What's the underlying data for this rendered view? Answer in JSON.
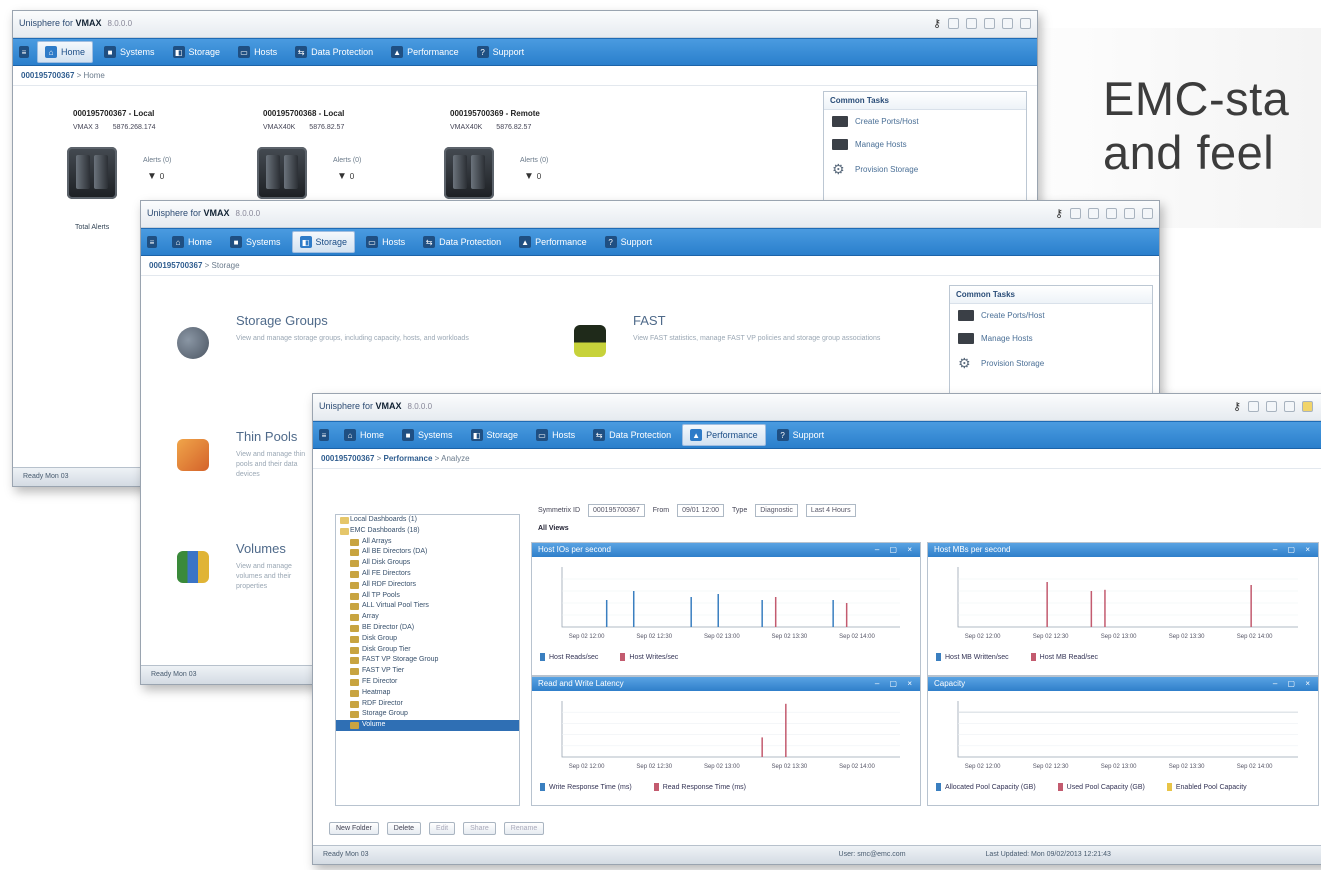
{
  "banner": {
    "line1": "EMC-sta",
    "line2": "and feel"
  },
  "app": {
    "title_prefix": "Unisphere for ",
    "title_bold": "VMAX",
    "version": "8.0.0.0"
  },
  "nav": {
    "w1": [
      {
        "label": "Home",
        "icon": "⌂",
        "active": true
      },
      {
        "label": "Systems",
        "icon": "■",
        "active": false
      },
      {
        "label": "Storage",
        "icon": "◧",
        "active": false
      },
      {
        "label": "Hosts",
        "icon": "▭",
        "active": false
      },
      {
        "label": "Data Protection",
        "icon": "⇆",
        "active": false
      },
      {
        "label": "Performance",
        "icon": "▲",
        "active": false
      },
      {
        "label": "Support",
        "icon": "?",
        "active": false
      }
    ],
    "w2": [
      {
        "label": "Home",
        "icon": "⌂",
        "active": false
      },
      {
        "label": "Systems",
        "icon": "■",
        "active": false
      },
      {
        "label": "Storage",
        "icon": "◧",
        "active": true
      },
      {
        "label": "Hosts",
        "icon": "▭",
        "active": false
      },
      {
        "label": "Data Protection",
        "icon": "⇆",
        "active": false
      },
      {
        "label": "Performance",
        "icon": "▲",
        "active": false
      },
      {
        "label": "Support",
        "icon": "?",
        "active": false
      }
    ],
    "w3": [
      {
        "label": "Home",
        "icon": "⌂",
        "active": false
      },
      {
        "label": "Systems",
        "icon": "■",
        "active": false
      },
      {
        "label": "Storage",
        "icon": "◧",
        "active": false
      },
      {
        "label": "Hosts",
        "icon": "▭",
        "active": false
      },
      {
        "label": "Data Protection",
        "icon": "⇆",
        "active": false
      },
      {
        "label": "Performance",
        "icon": "▲",
        "active": true
      },
      {
        "label": "Support",
        "icon": "?",
        "active": false
      }
    ]
  },
  "crumbs": {
    "w1": {
      "root": "000195700367",
      "sep": " > ",
      "leaf": "Home"
    },
    "w2": {
      "root": "000195700367",
      "sep": " > ",
      "leaf": "Storage"
    },
    "w3": {
      "root": "000195700367",
      "sep": " > ",
      "mid": "Performance",
      "leaf": "Analyze"
    }
  },
  "tasks": {
    "title": "Common Tasks",
    "items": [
      {
        "label": "Create Ports/Host",
        "icon": "server-icon"
      },
      {
        "label": "Manage Hosts",
        "icon": "server-icon"
      },
      {
        "label": "Provision Storage",
        "icon": "gear-icon"
      }
    ]
  },
  "systems": [
    {
      "id": "000195700367 - Local",
      "model": "VMAX 3",
      "ucode": "5876.268.174",
      "alerts_label": "Alerts (0)",
      "alerts": "0"
    },
    {
      "id": "000195700368 - Local",
      "model": "VMAX40K",
      "ucode": "5876.82.57",
      "alerts_label": "Alerts (0)",
      "alerts": "0"
    },
    {
      "id": "000195700369 - Remote",
      "model": "VMAX40K",
      "ucode": "5876.82.57",
      "alerts_label": "Alerts (0)",
      "alerts": "0"
    }
  ],
  "w1_status": "Ready    Mon 03",
  "w1_side_label": "Total Alerts",
  "features": [
    {
      "title": "Storage Groups",
      "desc": "View and manage storage groups, including capacity, hosts, and workloads"
    },
    {
      "title": "FAST",
      "desc": "View FAST statistics, manage FAST VP policies and storage group associations"
    },
    {
      "title": "Thin Pools",
      "desc": "View and manage thin pools and their data devices"
    },
    {
      "title": "Volumes",
      "desc": "View and manage volumes and their properties"
    }
  ],
  "w2_status": "Ready    Mon 03",
  "w3": {
    "toolbar": {
      "sym_label": "Symmetrix ID",
      "sym_value": "000195700367",
      "from_label": "From",
      "from_value": "09/01 12:00",
      "type_label": "Type",
      "type_value": "Diagnostic",
      "range_value": "Last 4 Hours",
      "all_label": "All Views"
    },
    "tree": [
      {
        "label": "Local Dashboards (1)",
        "root": true
      },
      {
        "label": "EMC Dashboards (18)",
        "root": true
      },
      {
        "label": "All Arrays"
      },
      {
        "label": "All BE Directors (DA)"
      },
      {
        "label": "All Disk Groups"
      },
      {
        "label": "All FE Directors"
      },
      {
        "label": "All RDF Directors"
      },
      {
        "label": "All TP Pools"
      },
      {
        "label": "ALL Virtual Pool Tiers"
      },
      {
        "label": "Array"
      },
      {
        "label": "BE Director (DA)"
      },
      {
        "label": "Disk Group"
      },
      {
        "label": "Disk Group Tier"
      },
      {
        "label": "FAST VP Storage Group"
      },
      {
        "label": "FAST VP Tier"
      },
      {
        "label": "FE Director"
      },
      {
        "label": "Heatmap"
      },
      {
        "label": "RDF Director"
      },
      {
        "label": "Storage Group"
      },
      {
        "label": "Volume",
        "selected": true
      }
    ],
    "buttons": [
      "New Folder",
      "Delete",
      "Edit",
      "Share",
      "Rename"
    ],
    "status": {
      "left": "Ready    Mon 03",
      "user": "User: smc@emc.com",
      "last": "Last Updated: Mon 09/02/2013 12:21:43"
    },
    "charts": [
      {
        "title": "Host IOs per second",
        "legend": [
          "Host Reads/sec",
          "Host Writes/sec"
        ]
      },
      {
        "title": "Host MBs per second",
        "legend": [
          "Host MB Written/sec",
          "Host MB Read/sec"
        ]
      },
      {
        "title": "Read and Write Latency",
        "legend": [
          "Write Response Time (ms)",
          "Read Response Time (ms)"
        ]
      },
      {
        "title": "Capacity",
        "legend": [
          "Allocated Pool Capacity (GB)",
          "Used Pool Capacity (GB)",
          "Enabled Pool Capacity"
        ]
      }
    ],
    "x_ticks": [
      "Sep 02 12:00",
      "Sep 02 12:30",
      "Sep 02 13:00",
      "Sep 02 13:30",
      "Sep 02 14:00"
    ]
  },
  "colors": {
    "nav": "#2a7fcc",
    "series_a": "#3a7fc0",
    "series_b": "#c35b6f",
    "series_c": "#e8c447"
  }
}
